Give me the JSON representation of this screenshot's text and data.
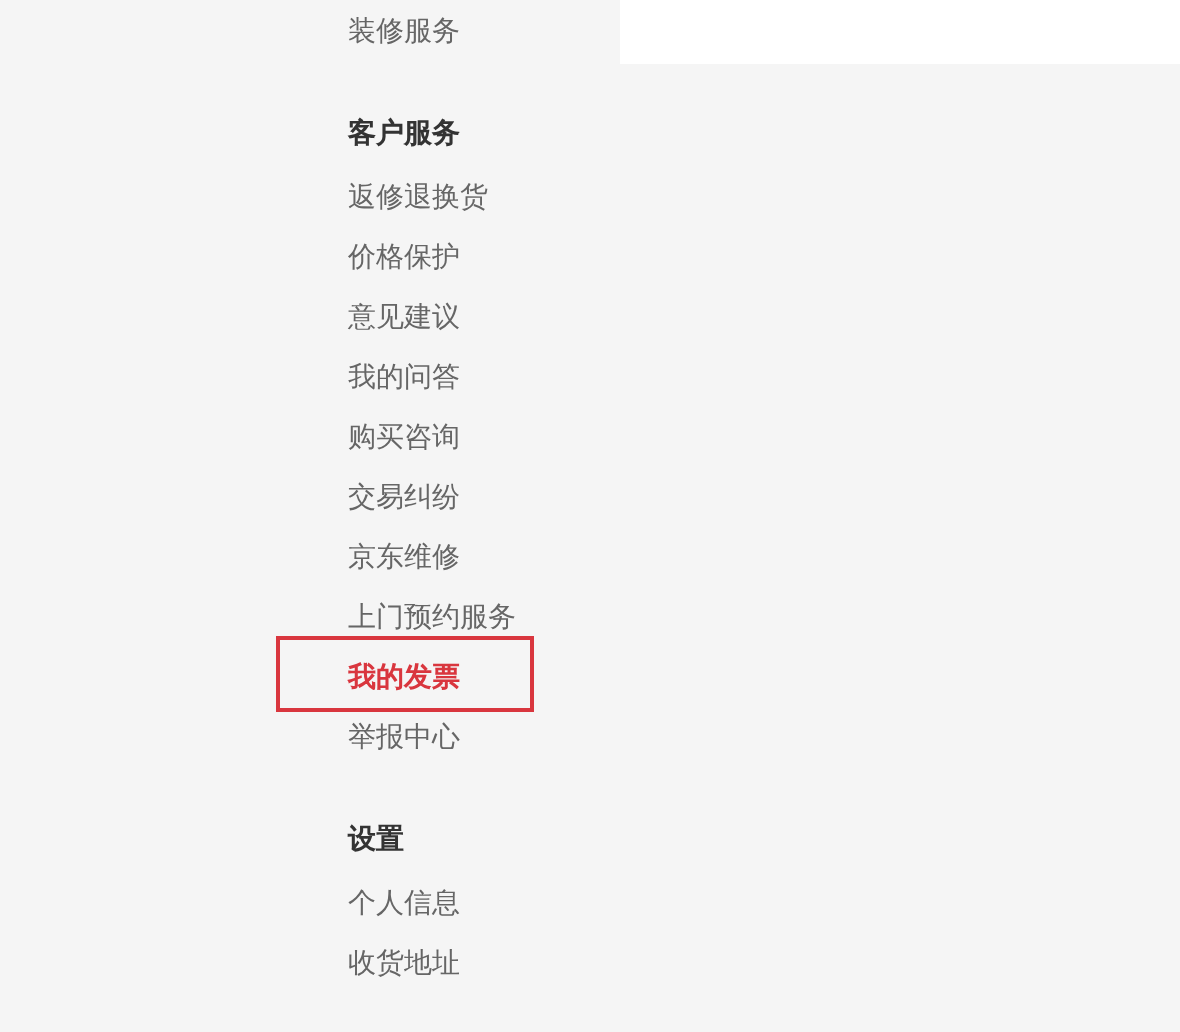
{
  "sections": [
    {
      "items": [
        {
          "label": "装修服务",
          "selected": false
        }
      ]
    },
    {
      "heading": "客户服务",
      "items": [
        {
          "label": "返修退换货",
          "selected": false
        },
        {
          "label": "价格保护",
          "selected": false
        },
        {
          "label": "意见建议",
          "selected": false
        },
        {
          "label": "我的问答",
          "selected": false
        },
        {
          "label": "购买咨询",
          "selected": false
        },
        {
          "label": "交易纠纷",
          "selected": false
        },
        {
          "label": "京东维修",
          "selected": false
        },
        {
          "label": "上门预约服务",
          "selected": false
        },
        {
          "label": "我的发票",
          "selected": true
        },
        {
          "label": "举报中心",
          "selected": false
        }
      ]
    },
    {
      "heading": "设置",
      "items": [
        {
          "label": "个人信息",
          "selected": false
        },
        {
          "label": "收货地址",
          "selected": false
        }
      ]
    }
  ]
}
